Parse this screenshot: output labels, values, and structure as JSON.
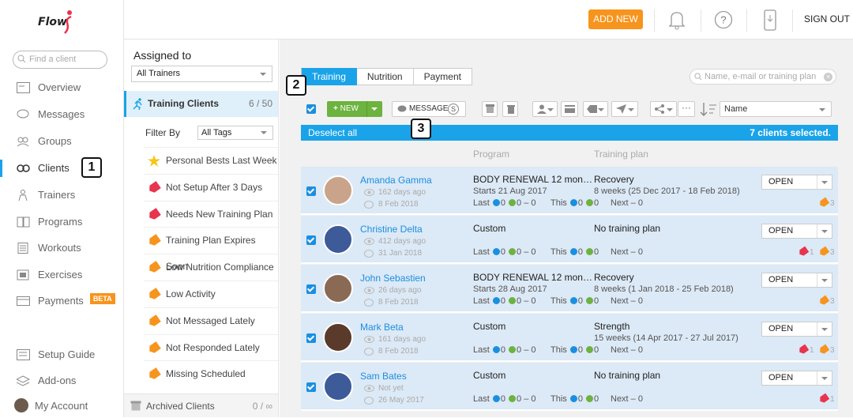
{
  "app": {
    "logo": "Flow"
  },
  "nav": {
    "search_placeholder": "Find a client",
    "items": [
      {
        "label": "Overview"
      },
      {
        "label": "Messages"
      },
      {
        "label": "Groups"
      },
      {
        "label": "Clients"
      },
      {
        "label": "Trainers"
      },
      {
        "label": "Programs"
      },
      {
        "label": "Workouts"
      },
      {
        "label": "Exercises"
      },
      {
        "label": "Payments",
        "badge": "BETA"
      }
    ],
    "bottom": [
      {
        "label": "Setup Guide"
      },
      {
        "label": "Add-ons"
      },
      {
        "label": "My Account"
      }
    ]
  },
  "header": {
    "add_new": "ADD NEW",
    "sign_out": "SIGN OUT"
  },
  "middle": {
    "assigned_to": "Assigned to",
    "trainer_select": "All Trainers",
    "training_clients": "Training Clients",
    "training_count": "6 / 50",
    "filter_by": "Filter By",
    "tag_select": "All Tags",
    "filters": [
      {
        "label": "Personal Bests Last Week",
        "color": "#f5c518",
        "icon": "star-icon"
      },
      {
        "label": "Not Setup After 3 Days",
        "color": "#e8344e",
        "icon": "tag-icon"
      },
      {
        "label": "Needs New Training Plan",
        "color": "#e8344e",
        "icon": "tag-icon"
      },
      {
        "label": "Training Plan Expires Soon",
        "color": "#f7941d",
        "icon": "tag-icon"
      },
      {
        "label": "Low Nutrition Compliance",
        "color": "#f7941d",
        "icon": "tag-icon"
      },
      {
        "label": "Low Activity",
        "color": "#f7941d",
        "icon": "tag-icon"
      },
      {
        "label": "Not Messaged Lately",
        "color": "#f7941d",
        "icon": "tag-icon"
      },
      {
        "label": "Not Responded Lately",
        "color": "#f7941d",
        "icon": "tag-icon"
      },
      {
        "label": "Missing Scheduled Workout",
        "color": "#f7941d",
        "icon": "tag-icon"
      }
    ],
    "archived": "Archived Clients",
    "archived_count": "0 / ∞"
  },
  "main": {
    "tabs": [
      {
        "label": "Training"
      },
      {
        "label": "Nutrition"
      },
      {
        "label": "Payment"
      }
    ],
    "search_placeholder": "Name, e-mail or training plan",
    "toolbar": {
      "new": "NEW",
      "message": "MESSAGE",
      "sort": "Name"
    },
    "deselect": "Deselect all",
    "selected": "7 clients selected.",
    "col_program": "Program",
    "col_plan": "Training plan",
    "last_label": "Last",
    "this_label": "This",
    "next_label": "Next",
    "open_label": "OPEN",
    "clients": [
      {
        "name": "Amanda Gamma",
        "ago": "162 days ago",
        "msg": "8 Feb 2018",
        "program": "BODY RENEWAL 12 mont…",
        "program_start": "Starts 21 Aug 2017",
        "plan": "Recovery",
        "plan_sub": "8 weeks (25 Dec 2017 - 18 Feb 2018)",
        "last": "0   0 – 0",
        "this": "0   0",
        "next": "0",
        "tags_orange": "3",
        "tags_red": ""
      },
      {
        "name": "Christine Delta",
        "ago": "412 days ago",
        "msg": "31 Jan 2018",
        "program": "Custom",
        "program_start": "",
        "plan": "No training plan",
        "plan_sub": "",
        "last": "0   0 – 0",
        "this": "0   0",
        "next": "0",
        "tags_orange": "3",
        "tags_red": "1"
      },
      {
        "name": "John Sebastien",
        "ago": "26 days ago",
        "msg": "8 Feb 2018",
        "program": "BODY RENEWAL 12 mont…",
        "program_start": "Starts 28 Aug 2017",
        "plan": "Recovery",
        "plan_sub": "8 weeks (1 Jan 2018 - 25 Feb 2018)",
        "last": "0   0 – 0",
        "this": "0   0",
        "next": "0",
        "tags_orange": "3",
        "tags_red": ""
      },
      {
        "name": "Mark Beta",
        "ago": "161 days ago",
        "msg": "8 Feb 2018",
        "program": "Custom",
        "program_start": "",
        "plan": "Strength",
        "plan_sub": "15 weeks (14 Apr 2017 - 27 Jul 2017)",
        "last": "0   0 – 0",
        "this": "0   0",
        "next": "0",
        "tags_orange": "3",
        "tags_red": "1"
      },
      {
        "name": "Sam Bates",
        "ago": "Not yet",
        "msg": "26 May 2017",
        "program": "Custom",
        "program_start": "",
        "plan": "No training plan",
        "plan_sub": "",
        "last": "0   0 – 0",
        "this": "0   0",
        "next": "0",
        "tags_orange": "",
        "tags_red": "1"
      }
    ]
  },
  "annotations": [
    "1",
    "2",
    "3"
  ],
  "colors": {
    "accent": "#1aa3e8",
    "orange": "#f7941d",
    "green": "#6cb33f",
    "red": "#e8344e"
  }
}
